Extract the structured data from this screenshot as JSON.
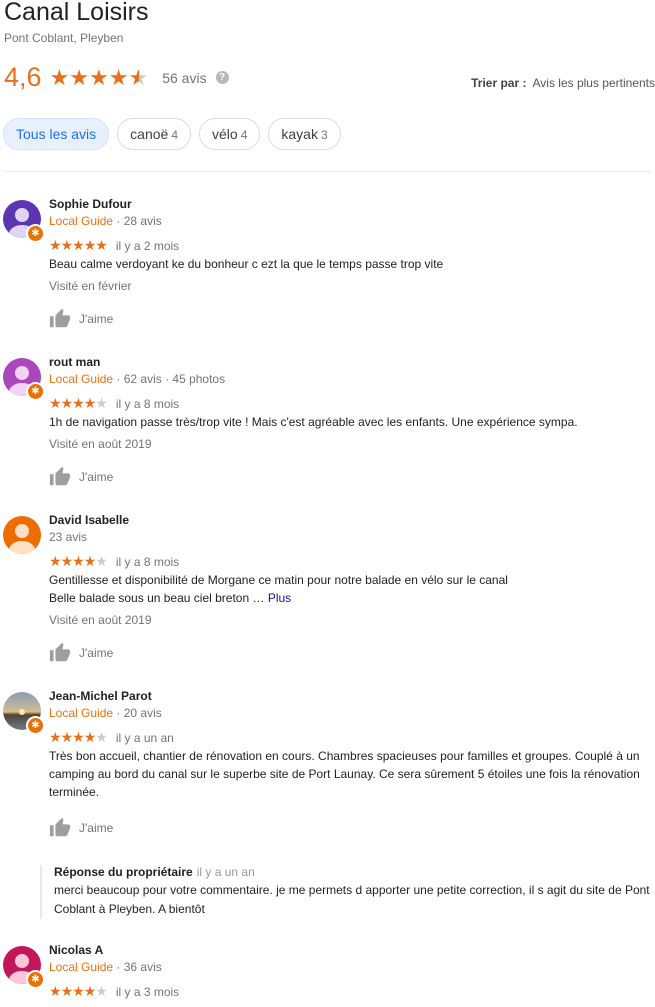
{
  "business": {
    "title": "Canal Loisirs",
    "address": "Pont Coblant, Pleyben",
    "rating": "4,6",
    "rating_value": 4.6,
    "reviews_count": "56 avis"
  },
  "sort": {
    "label": "Trier par :",
    "value": "Avis les plus pertinents"
  },
  "filters": [
    {
      "label": "Tous les avis",
      "count": ""
    },
    {
      "label": "canoë",
      "count": "4"
    },
    {
      "label": "vélo",
      "count": "4"
    },
    {
      "label": "kayak",
      "count": "3"
    }
  ],
  "colors": {
    "star": "#e7711b",
    "local_guide": "#e8710a",
    "chip_active_bg": "#e8f0fe",
    "link": "#1a0dab"
  },
  "reviews": [
    {
      "name": "Sophie Dufour",
      "local_guide": "Local Guide",
      "meta": " · 28 avis",
      "stars": 5,
      "date": "il y a 2 mois",
      "text": "Beau calme verdoyant ke du bonheur c ezt la que le temps passe trop vite",
      "more": "",
      "visited": "Visité en février",
      "like": "J'aime",
      "avatar_color": "#5e35b1"
    },
    {
      "name": "rout man",
      "local_guide": "Local Guide",
      "meta": " · 62 avis · 45 photos",
      "stars": 4,
      "date": "il y a 8 mois",
      "text": "1h de navigation passe très/trop vite ! Mais c'est agréable avec les enfants. Une expérience sympa.",
      "more": "",
      "visited": "Visité en août 2019",
      "like": "J'aime",
      "avatar_color": "#ab47bc"
    },
    {
      "name": "David Isabelle",
      "local_guide": "",
      "meta": "23 avis",
      "stars": 4,
      "date": "il y a 8 mois",
      "text": "Gentillesse et disponibilité de Morgane ce matin pour notre balade en vélo sur le canal\nBelle balade sous un beau ciel breton … ",
      "more": "Plus",
      "visited": "Visité en août 2019",
      "like": "J'aime",
      "avatar_color": "#ef6c00"
    },
    {
      "name": "Jean-Michel Parot",
      "local_guide": "Local Guide",
      "meta": " · 20 avis",
      "stars": 4,
      "date": "il y a un an",
      "text": "Très bon accueil, chantier de rénovation en cours. Chambres spacieuses pour familles et groupes. Couplé à un camping au bord du canal sur le superbe site de Port Launay. Ce sera sûrement 5 étoiles une fois la rénovation terminée.",
      "more": "",
      "visited": "",
      "like": "J'aime",
      "avatar_color": "#6d4c41"
    },
    {
      "name": "Nicolas A",
      "local_guide": "Local Guide",
      "meta": " · 36 avis",
      "stars": 4,
      "date": "il y a 3 mois",
      "text": "",
      "more": "",
      "visited": "",
      "like": "",
      "avatar_color": "#c2185b"
    }
  ],
  "owner_reply": {
    "label": "Réponse du propriétaire",
    "date": "il y a un an",
    "text": "merci beaucoup pour votre commentaire. je me permets d apporter une petite correction, il s agit du site de Pont Coblant à Pleyben. A bientôt"
  }
}
